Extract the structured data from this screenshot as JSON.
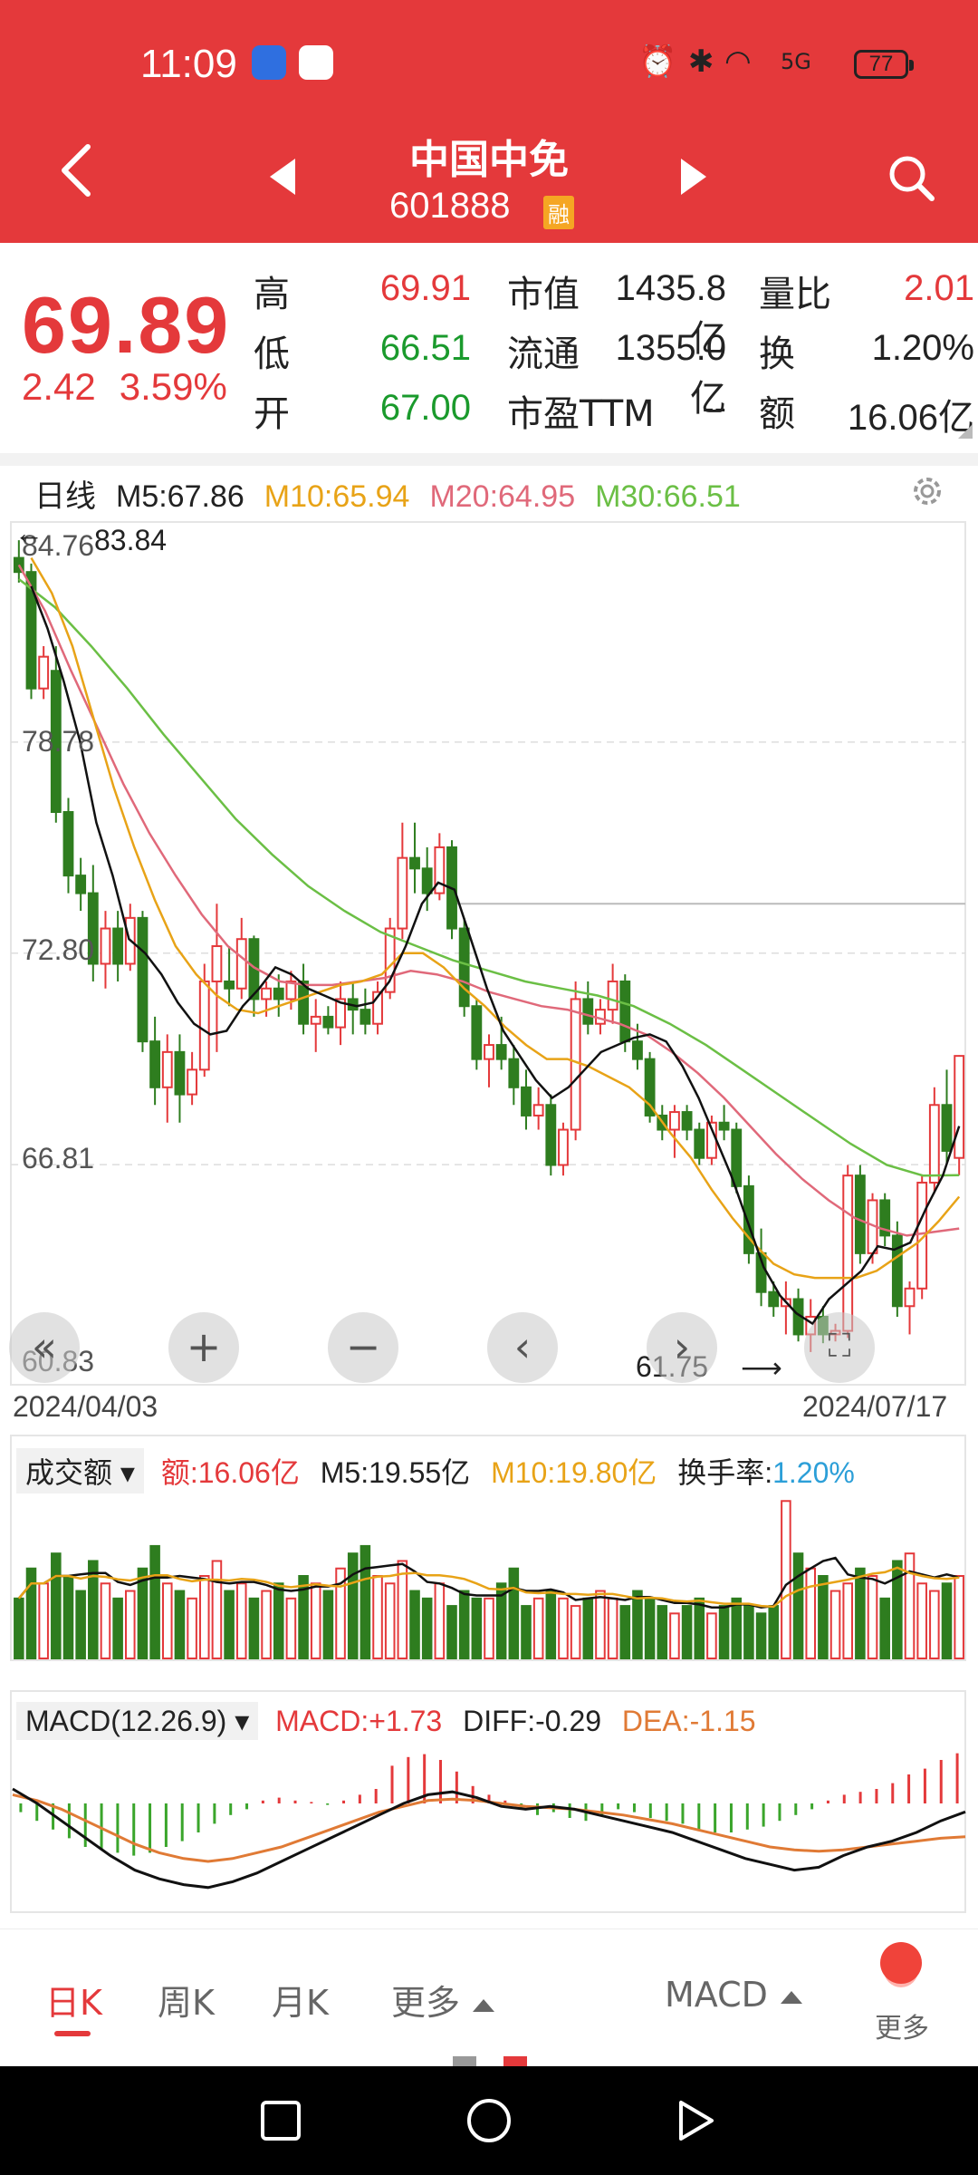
{
  "status_bar": {
    "time": "11:09",
    "battery": "77",
    "network": "5G"
  },
  "header": {
    "stock_name": "中国中免",
    "stock_code": "601888",
    "margin_badge": "融"
  },
  "quote": {
    "price": "69.89",
    "change": "2.42",
    "change_pct": "3.59%",
    "labels": {
      "high": "高",
      "low": "低",
      "open": "开",
      "market_cap": "市值",
      "float_cap": "流通",
      "pe": "市盈TTM",
      "vol_ratio": "量比",
      "turnover": "换",
      "amount": "额"
    },
    "values": {
      "high": "69.91",
      "low": "66.51",
      "open": "67.00",
      "market_cap": "1435.8亿",
      "float_cap": "1355.0亿",
      "pe": "--",
      "vol_ratio": "2.01",
      "turnover": "1.20%",
      "amount": "16.06亿"
    }
  },
  "kline": {
    "period": "日线",
    "ma5": "M5:67.86",
    "ma10": "M10:65.94",
    "ma20": "M20:64.95",
    "ma30": "M30:66.51",
    "price_labels": [
      "84.76",
      "78.78",
      "72.80",
      "66.81",
      "60.83"
    ],
    "max_marker": "83.84",
    "min_marker": "61.75",
    "start_date": "2024/04/03",
    "end_date": "2024/07/17",
    "controls": [
      "«",
      "+",
      "−",
      "‹",
      "›"
    ]
  },
  "volume": {
    "selector": "成交额",
    "amount": "额:16.06亿",
    "ma5": "M5:19.55亿",
    "ma10": "M10:19.80亿",
    "turnover_label": "换手率:",
    "turnover_value": "1.20%"
  },
  "macd": {
    "selector": "MACD(12.26.9)",
    "macd": "MACD:+1.73",
    "diff": "DIFF:-0.29",
    "dea": "DEA:-1.15"
  },
  "tabs": {
    "day": "日K",
    "week": "周K",
    "month": "月K",
    "more": "更多",
    "indicator": "MACD",
    "more_right": "更多"
  },
  "colors": {
    "up": "#e4393b",
    "down": "#2e7d1f",
    "ma5": "#111111",
    "ma10": "#e8a317",
    "ma20": "#e0697a",
    "ma30": "#6bbf45"
  },
  "chart_data": {
    "type": "candlestick",
    "title": "中国中免 日线",
    "x_range": [
      "2024/04/03",
      "2024/07/17"
    ],
    "ylim": [
      60.83,
      84.76
    ],
    "ohlc": [
      [
        84.0,
        84.5,
        83.3,
        83.6
      ],
      [
        83.6,
        83.84,
        80.0,
        80.3
      ],
      [
        80.3,
        81.5,
        80.0,
        81.2
      ],
      [
        80.8,
        81.5,
        76.5,
        76.8
      ],
      [
        76.8,
        77.2,
        74.5,
        75.0
      ],
      [
        75.0,
        75.5,
        74.0,
        74.5
      ],
      [
        74.5,
        75.3,
        72.0,
        72.5
      ],
      [
        72.5,
        74.0,
        71.8,
        73.5
      ],
      [
        73.5,
        74.0,
        72.0,
        72.5
      ],
      [
        72.5,
        74.2,
        72.3,
        73.8
      ],
      [
        73.8,
        74.0,
        70.0,
        70.3
      ],
      [
        70.3,
        71.0,
        68.5,
        69.0
      ],
      [
        69.0,
        70.5,
        68.0,
        70.0
      ],
      [
        70.0,
        70.5,
        68.0,
        68.8
      ],
      [
        68.8,
        70.0,
        68.5,
        69.5
      ],
      [
        69.5,
        72.5,
        69.3,
        72.0
      ],
      [
        72.0,
        74.2,
        70.0,
        73.0
      ],
      [
        72.0,
        73.0,
        71.3,
        71.8
      ],
      [
        71.8,
        73.8,
        71.5,
        73.2
      ],
      [
        73.2,
        73.3,
        71.0,
        71.5
      ],
      [
        71.5,
        72.0,
        71.0,
        71.8
      ],
      [
        71.8,
        72.2,
        71.0,
        71.5
      ],
      [
        71.5,
        72.3,
        71.2,
        72.0
      ],
      [
        72.0,
        72.5,
        70.5,
        70.8
      ],
      [
        70.8,
        71.5,
        70.0,
        71.0
      ],
      [
        71.0,
        71.3,
        70.5,
        70.7
      ],
      [
        70.7,
        72.0,
        70.2,
        71.5
      ],
      [
        71.5,
        72.0,
        70.5,
        71.2
      ],
      [
        71.2,
        71.8,
        70.5,
        70.8
      ],
      [
        70.8,
        72.0,
        70.5,
        71.7
      ],
      [
        71.7,
        73.8,
        71.5,
        73.5
      ],
      [
        73.5,
        76.5,
        73.2,
        75.5
      ],
      [
        75.5,
        76.5,
        74.5,
        75.2
      ],
      [
        75.2,
        75.8,
        74.0,
        74.5
      ],
      [
        74.5,
        76.2,
        74.3,
        75.8
      ],
      [
        75.8,
        76.0,
        73.2,
        73.5
      ],
      [
        73.5,
        73.8,
        71.0,
        71.3
      ],
      [
        71.3,
        71.5,
        69.5,
        69.8
      ],
      [
        69.8,
        70.5,
        69.0,
        70.2
      ],
      [
        70.2,
        71.0,
        69.5,
        69.8
      ],
      [
        69.8,
        70.2,
        68.5,
        69.0
      ],
      [
        69.0,
        69.5,
        67.8,
        68.2
      ],
      [
        68.2,
        69.0,
        67.8,
        68.5
      ],
      [
        68.5,
        68.8,
        66.5,
        66.8
      ],
      [
        66.8,
        68.0,
        66.5,
        67.8
      ],
      [
        67.8,
        72.0,
        67.5,
        71.5
      ],
      [
        71.5,
        72.0,
        70.5,
        70.8
      ],
      [
        70.8,
        71.5,
        70.5,
        71.2
      ],
      [
        71.2,
        72.5,
        70.8,
        72.0
      ],
      [
        72.0,
        72.2,
        70.0,
        70.3
      ],
      [
        70.3,
        70.8,
        69.5,
        69.8
      ],
      [
        69.8,
        70.0,
        68.0,
        68.2
      ],
      [
        68.2,
        68.5,
        67.5,
        67.8
      ],
      [
        67.8,
        68.5,
        67.0,
        68.3
      ],
      [
        68.3,
        68.5,
        67.5,
        67.8
      ],
      [
        67.8,
        68.0,
        66.8,
        67.0
      ],
      [
        67.0,
        68.2,
        66.8,
        68.0
      ],
      [
        68.0,
        68.5,
        67.5,
        67.8
      ],
      [
        67.8,
        68.0,
        66.0,
        66.2
      ],
      [
        66.2,
        66.5,
        64.0,
        64.3
      ],
      [
        64.3,
        65.0,
        62.8,
        63.2
      ],
      [
        63.2,
        63.5,
        62.5,
        62.8
      ],
      [
        62.8,
        63.5,
        62.0,
        63.0
      ],
      [
        63.0,
        63.3,
        61.8,
        62.0
      ],
      [
        62.0,
        63.0,
        61.5,
        62.5
      ],
      [
        62.5,
        62.8,
        61.75,
        62.0
      ],
      [
        62.0,
        62.3,
        61.8,
        62.1
      ],
      [
        62.1,
        66.8,
        61.9,
        66.5
      ],
      [
        66.5,
        66.8,
        64.0,
        64.3
      ],
      [
        64.3,
        66.0,
        64.0,
        65.8
      ],
      [
        65.8,
        66.0,
        64.5,
        64.8
      ],
      [
        64.8,
        65.2,
        62.5,
        62.8
      ],
      [
        62.8,
        63.5,
        62.0,
        63.3
      ],
      [
        63.3,
        66.5,
        63.0,
        66.3
      ],
      [
        66.3,
        69.0,
        66.0,
        68.5
      ],
      [
        68.5,
        69.5,
        66.8,
        67.2
      ],
      [
        67.0,
        69.91,
        66.51,
        69.89
      ]
    ],
    "ma5": [
      83.2,
      82.0,
      80.5,
      78.8,
      76.5,
      75.0,
      73.2,
      72.8,
      72.2,
      71.4,
      70.8,
      70.5,
      70.6,
      71.3,
      71.8,
      72.4,
      72.2,
      71.8,
      71.6,
      71.4,
      71.3,
      71.4,
      72.0,
      73.0,
      74.2,
      74.8,
      74.6,
      73.2,
      71.8,
      70.6,
      69.9,
      69.2,
      68.7,
      69.0,
      69.5,
      70.0,
      70.2,
      70.4,
      70.5,
      70.3,
      69.6,
      68.7,
      67.6,
      66.5,
      65.2,
      63.9,
      63.1,
      62.6,
      62.3,
      63.0,
      63.4,
      63.8,
      64.5,
      64.4,
      64.6,
      65.6,
      66.5,
      67.9
    ],
    "ma10": [
      84.0,
      83.0,
      81.5,
      79.5,
      77.5,
      75.8,
      74.3,
      73.0,
      72.2,
      71.6,
      71.2,
      71.1,
      71.3,
      71.5,
      71.7,
      71.9,
      72.0,
      72.2,
      72.8,
      72.8,
      72.4,
      71.8,
      71.3,
      70.7,
      70.2,
      69.8,
      69.8,
      69.6,
      69.3,
      69.0,
      68.5,
      67.7,
      67.0,
      66.1,
      65.3,
      64.6,
      64.0,
      63.7,
      63.6,
      63.6,
      63.6,
      63.8,
      64.2,
      64.6,
      65.2,
      65.9
    ],
    "ma20": [
      83.8,
      82.5,
      80.8,
      79.2,
      77.6,
      76.2,
      75.0,
      73.9,
      73.0,
      72.4,
      72.0,
      71.9,
      71.9,
      72.0,
      72.1,
      72.3,
      72.2,
      72.0,
      71.7,
      71.5,
      71.3,
      71.2,
      71.0,
      70.8,
      70.5,
      70.0,
      69.4,
      68.7,
      67.9,
      67.1,
      66.4,
      65.8,
      65.3,
      65.0,
      64.8,
      64.9,
      65.0
    ],
    "ma30": [
      83.4,
      82.6,
      81.5,
      80.3,
      79.0,
      77.8,
      76.6,
      75.6,
      74.7,
      74.0,
      73.4,
      73.0,
      72.6,
      72.3,
      72.0,
      71.8,
      71.6,
      71.3,
      70.8,
      70.2,
      69.5,
      68.8,
      68.1,
      67.4,
      66.8,
      66.5,
      66.51
    ],
    "volume": [
      8,
      12,
      10,
      14,
      11,
      9,
      13,
      10,
      8,
      9,
      12,
      15,
      10,
      9,
      8,
      11,
      13,
      9,
      10,
      8,
      9,
      10,
      8,
      11,
      10,
      9,
      12,
      14,
      15,
      11,
      10,
      13,
      9,
      8,
      10,
      7,
      9,
      8,
      8,
      10,
      12,
      7,
      8,
      9,
      8,
      7,
      8,
      9,
      8,
      7,
      9,
      8,
      7,
      6,
      7,
      8,
      6,
      7,
      8,
      7,
      6,
      7,
      21,
      14,
      12,
      11,
      9,
      10,
      12,
      11,
      8,
      13,
      14,
      10,
      9,
      10,
      11
    ],
    "macd_hist": [
      -0.3,
      -0.6,
      -0.9,
      -1.2,
      -1.5,
      -1.6,
      -1.7,
      -1.8,
      -1.7,
      -1.5,
      -1.3,
      -1.0,
      -0.7,
      -0.4,
      -0.2,
      0.1,
      0.2,
      0.1,
      0.05,
      -0.05,
      0.1,
      0.3,
      0.5,
      1.3,
      1.6,
      1.7,
      1.5,
      1.1,
      0.6,
      0.3,
      0.1,
      -0.2,
      -0.4,
      -0.3,
      -0.5,
      -0.6,
      -0.4,
      -0.2,
      -0.3,
      -0.5,
      -0.6,
      -0.7,
      -0.9,
      -1.0,
      -1.0,
      -0.9,
      -0.8,
      -0.6,
      -0.4,
      -0.2,
      0.1,
      0.3,
      0.4,
      0.5,
      0.7,
      1.0,
      1.2,
      1.5,
      1.73
    ],
    "dif": [
      0.5,
      0.0,
      -0.6,
      -1.2,
      -1.8,
      -2.3,
      -2.6,
      -2.8,
      -2.9,
      -2.7,
      -2.4,
      -2.0,
      -1.6,
      -1.2,
      -0.8,
      -0.4,
      0.0,
      0.3,
      0.4,
      0.2,
      -0.1,
      -0.2,
      -0.1,
      -0.2,
      -0.4,
      -0.6,
      -0.8,
      -1.0,
      -1.3,
      -1.6,
      -1.9,
      -2.1,
      -2.3,
      -2.2,
      -1.8,
      -1.5,
      -1.3,
      -1.0,
      -0.6,
      -0.29
    ],
    "dea": [
      0.3,
      0.1,
      -0.2,
      -0.6,
      -1.0,
      -1.4,
      -1.7,
      -1.9,
      -2.0,
      -1.9,
      -1.7,
      -1.5,
      -1.2,
      -0.9,
      -0.6,
      -0.3,
      -0.1,
      0.1,
      0.15,
      0.1,
      0.0,
      -0.1,
      -0.15,
      -0.2,
      -0.3,
      -0.4,
      -0.55,
      -0.7,
      -0.9,
      -1.1,
      -1.3,
      -1.5,
      -1.6,
      -1.65,
      -1.6,
      -1.5,
      -1.4,
      -1.3,
      -1.2,
      -1.15
    ]
  }
}
